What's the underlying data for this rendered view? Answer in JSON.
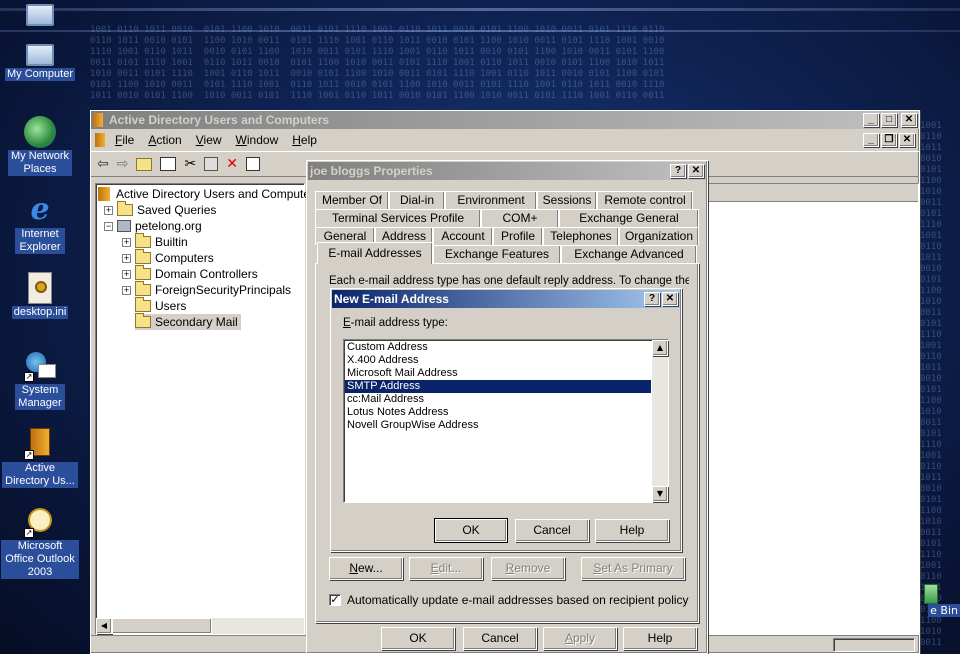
{
  "desktop": {
    "icons": [
      {
        "label": "My Computer"
      },
      {
        "label": "My Network Places"
      },
      {
        "label": "Internet Explorer"
      },
      {
        "label": "desktop.ini"
      },
      {
        "label": "System Manager"
      },
      {
        "label": "Active Directory Us..."
      },
      {
        "label": "Microsoft Office Outlook 2003"
      }
    ],
    "recycle_bin_partial": "e Bin"
  },
  "aduc": {
    "title": "Active Directory Users and Computers",
    "menu": [
      "File",
      "Action",
      "View",
      "Window",
      "Help"
    ],
    "tree": {
      "root": "Active Directory Users and Computers",
      "items": [
        "Saved Queries",
        "petelong.org",
        "Builtin",
        "Computers",
        "Domain Controllers",
        "ForeignSecurityPrincipals",
        "Users",
        "Secondary Mail"
      ]
    }
  },
  "props": {
    "title": "joe bloggs Properties",
    "tabs_row1": [
      "Member Of",
      "Dial-in",
      "Environment",
      "Sessions",
      "Remote control"
    ],
    "tabs_row2": [
      "Terminal Services Profile",
      "COM+",
      "Exchange General"
    ],
    "tabs_row3": [
      "General",
      "Address",
      "Account",
      "Profile",
      "Telephones",
      "Organization"
    ],
    "tabs_row4": [
      "E-mail Addresses",
      "Exchange Features",
      "Exchange Advanced"
    ],
    "info_text": "Each e-mail address type has one default reply address. To change the",
    "buttons": {
      "new": "New...",
      "edit": "Edit...",
      "remove": "Remove",
      "set_primary": "Set As Primary"
    },
    "auto_update": "Automatically update e-mail addresses based on recipient policy",
    "footer": {
      "ok": "OK",
      "cancel": "Cancel",
      "apply": "Apply",
      "help": "Help"
    }
  },
  "new_email": {
    "title": "New E-mail Address",
    "type_label": "E-mail address type:",
    "types": [
      "Custom Address",
      "X.400 Address",
      "Microsoft Mail Address",
      "SMTP Address",
      "cc:Mail Address",
      "Lotus Notes Address",
      "Novell GroupWise Address"
    ],
    "selected": "SMTP Address",
    "ok": "OK",
    "cancel": "Cancel",
    "help": "Help"
  }
}
